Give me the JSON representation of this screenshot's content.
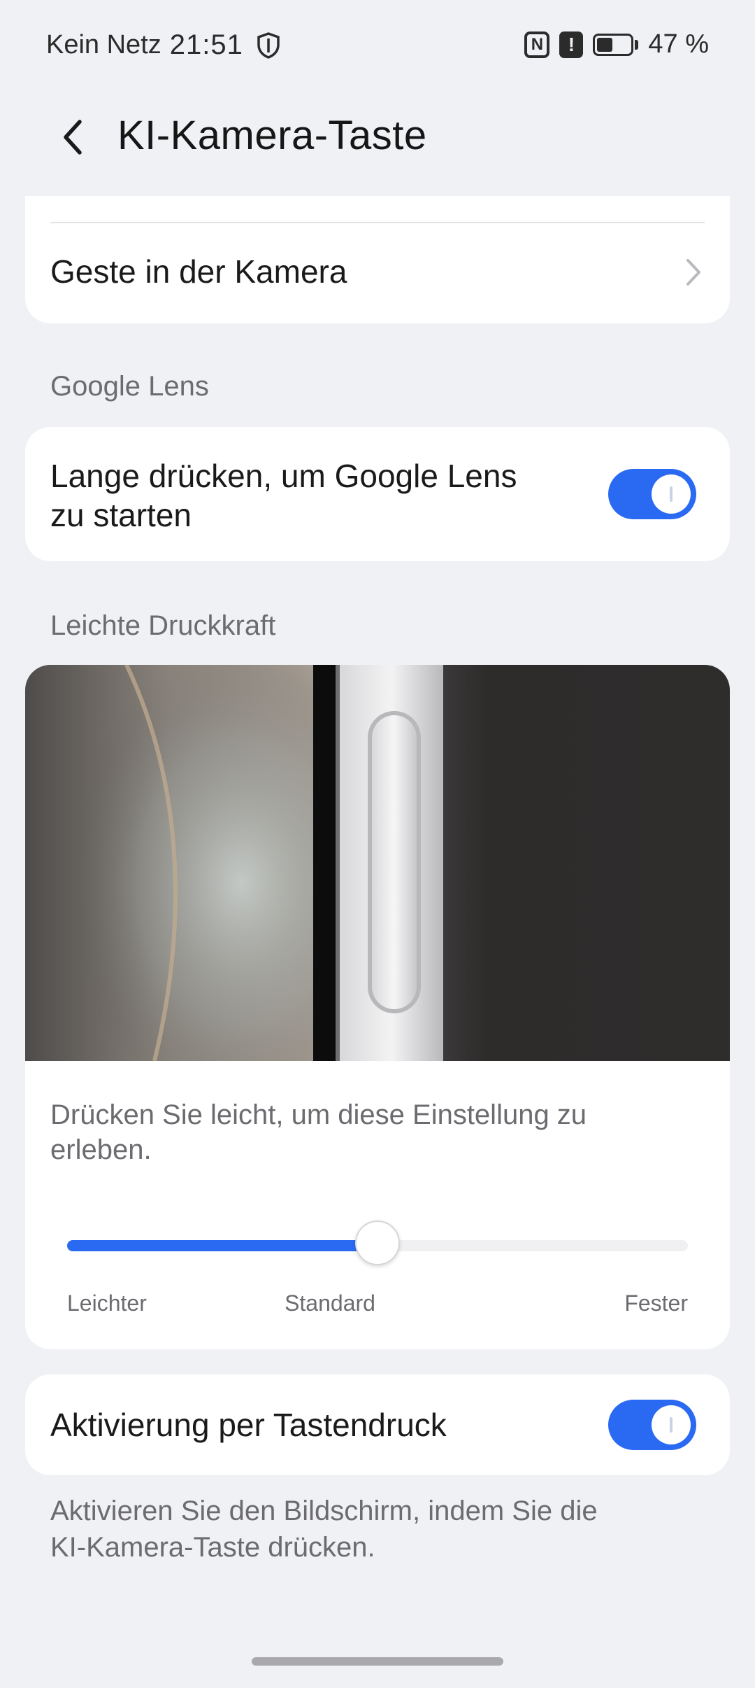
{
  "status_bar": {
    "carrier": "Kein Netz",
    "time": "21:51",
    "nfc_glyph": "N",
    "alert_glyph": "!",
    "battery_level": 0.47,
    "battery_text": "47 %",
    "icons": [
      "shield-icon",
      "nfc-icon",
      "alert-icon",
      "battery-icon"
    ]
  },
  "header": {
    "title": "KI-Kamera-Taste",
    "back_icon": "chevron-left"
  },
  "top_card": {
    "row_label": "Geste in der Kamera",
    "chevron_icon": "chevron-right"
  },
  "google_lens": {
    "section_title": "Google Lens",
    "toggle_label_line1": "Lange drücken, um Google Lens",
    "toggle_label_line2": "zu starten",
    "enabled": true
  },
  "pressure": {
    "section_title": "Leichte Druckkraft",
    "hint_line1": "Drücken Sie leicht, um diese Einstellung zu",
    "hint_line2": "erleben.",
    "slider_value": 0.5,
    "tick_labels": [
      "Leichter",
      "Standard",
      "Fester"
    ]
  },
  "wake": {
    "toggle_label": "Aktivierung per Tastendruck",
    "enabled": true,
    "description_line1": "Aktivieren Sie den Bildschirm, indem Sie die",
    "description_line2": "KI-Kamera-Taste drücken."
  },
  "colors": {
    "accent": "#2a6af3",
    "background": "#f0f1f5",
    "card": "#ffffff",
    "secondary_text": "#6b6b70"
  }
}
